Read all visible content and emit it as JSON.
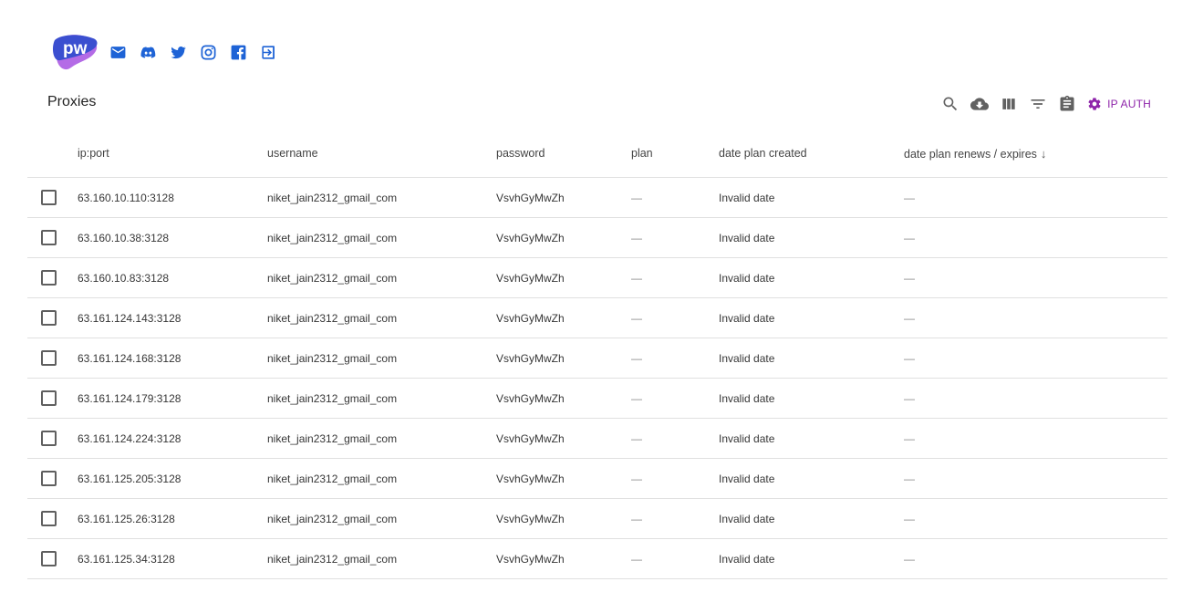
{
  "brand": {
    "logo_text": "pw"
  },
  "social_icons": [
    "mail-icon",
    "discord-icon",
    "twitter-icon",
    "instagram-icon",
    "facebook-icon",
    "logout-icon"
  ],
  "toolbar": {
    "title": "Proxies",
    "actions": [
      "search-icon",
      "cloud-download-icon",
      "view-columns-icon",
      "filter-icon",
      "clipboard-icon"
    ],
    "ip_auth_label": "IP AUTH"
  },
  "table": {
    "headers": {
      "ip": "ip:port",
      "username": "username",
      "password": "password",
      "plan": "plan",
      "created": "date plan created",
      "renews": "date plan renews / expires"
    },
    "sort_indicator": "↓",
    "rows": [
      {
        "ip": "63.160.10.110:3128",
        "username": "niket_jain2312_gmail_com",
        "password": "VsvhGyMwZh",
        "plan": "—",
        "created": "Invalid date",
        "renews": "—"
      },
      {
        "ip": "63.160.10.38:3128",
        "username": "niket_jain2312_gmail_com",
        "password": "VsvhGyMwZh",
        "plan": "—",
        "created": "Invalid date",
        "renews": "—"
      },
      {
        "ip": "63.160.10.83:3128",
        "username": "niket_jain2312_gmail_com",
        "password": "VsvhGyMwZh",
        "plan": "—",
        "created": "Invalid date",
        "renews": "—"
      },
      {
        "ip": "63.161.124.143:3128",
        "username": "niket_jain2312_gmail_com",
        "password": "VsvhGyMwZh",
        "plan": "—",
        "created": "Invalid date",
        "renews": "—"
      },
      {
        "ip": "63.161.124.168:3128",
        "username": "niket_jain2312_gmail_com",
        "password": "VsvhGyMwZh",
        "plan": "—",
        "created": "Invalid date",
        "renews": "—"
      },
      {
        "ip": "63.161.124.179:3128",
        "username": "niket_jain2312_gmail_com",
        "password": "VsvhGyMwZh",
        "plan": "—",
        "created": "Invalid date",
        "renews": "—"
      },
      {
        "ip": "63.161.124.224:3128",
        "username": "niket_jain2312_gmail_com",
        "password": "VsvhGyMwZh",
        "plan": "—",
        "created": "Invalid date",
        "renews": "—"
      },
      {
        "ip": "63.161.125.205:3128",
        "username": "niket_jain2312_gmail_com",
        "password": "VsvhGyMwZh",
        "plan": "—",
        "created": "Invalid date",
        "renews": "—"
      },
      {
        "ip": "63.161.125.26:3128",
        "username": "niket_jain2312_gmail_com",
        "password": "VsvhGyMwZh",
        "plan": "—",
        "created": "Invalid date",
        "renews": "—"
      },
      {
        "ip": "63.161.125.34:3128",
        "username": "niket_jain2312_gmail_com",
        "password": "VsvhGyMwZh",
        "plan": "—",
        "created": "Invalid date",
        "renews": "—"
      }
    ]
  },
  "colors": {
    "social_blue": "#1e63d6",
    "accent_purple": "#8e24aa",
    "logo_blue": "#3b4fd0",
    "logo_purple": "#b46be6"
  }
}
